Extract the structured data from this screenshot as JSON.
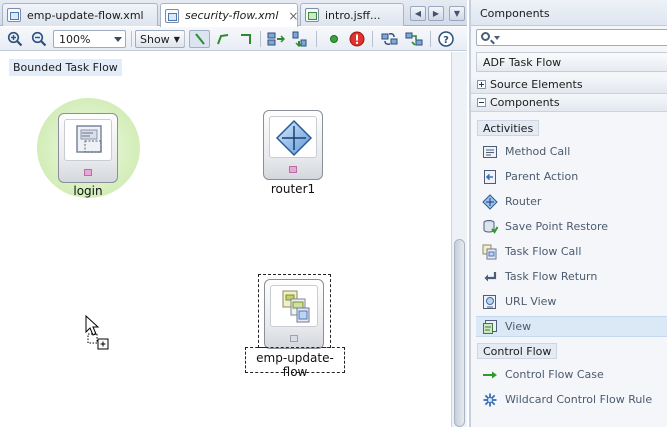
{
  "tabs": [
    {
      "label": "emp-update-flow.xml",
      "active": false
    },
    {
      "label": "security-flow.xml",
      "active": true
    },
    {
      "label": "intro.jsff...",
      "active": false
    }
  ],
  "toolbar": {
    "zoom_value": "100%",
    "show_label": "Show"
  },
  "canvas": {
    "chip_label": "Bounded Task Flow",
    "nodes": {
      "login": "login",
      "router": "router1",
      "emp": "emp-update-flow"
    }
  },
  "palette": {
    "title": "Components",
    "search_placeholder": "",
    "library": "ADF Task Flow",
    "sections": {
      "source_elements": "Source Elements",
      "components": "Components"
    },
    "activities_label": "Activities",
    "activities": [
      {
        "label": "Method Call",
        "icon": "method-call-icon"
      },
      {
        "label": "Parent Action",
        "icon": "parent-action-icon"
      },
      {
        "label": "Router",
        "icon": "router-icon"
      },
      {
        "label": "Save Point Restore",
        "icon": "save-point-restore-icon"
      },
      {
        "label": "Task Flow Call",
        "icon": "task-flow-call-icon"
      },
      {
        "label": "Task Flow Return",
        "icon": "task-flow-return-icon"
      },
      {
        "label": "URL View",
        "icon": "url-view-icon"
      },
      {
        "label": "View",
        "icon": "view-icon",
        "selected": true
      }
    ],
    "control_flow_label": "Control Flow",
    "control_flow": [
      {
        "label": "Control Flow Case",
        "icon": "control-flow-case-icon"
      },
      {
        "label": "Wildcard Control Flow Rule",
        "icon": "wildcard-control-flow-rule-icon"
      }
    ]
  },
  "colors": {
    "accent_blue": "#3a6fb5",
    "halo_green": "#c7e8a5",
    "selection": "#dbe9f7"
  }
}
